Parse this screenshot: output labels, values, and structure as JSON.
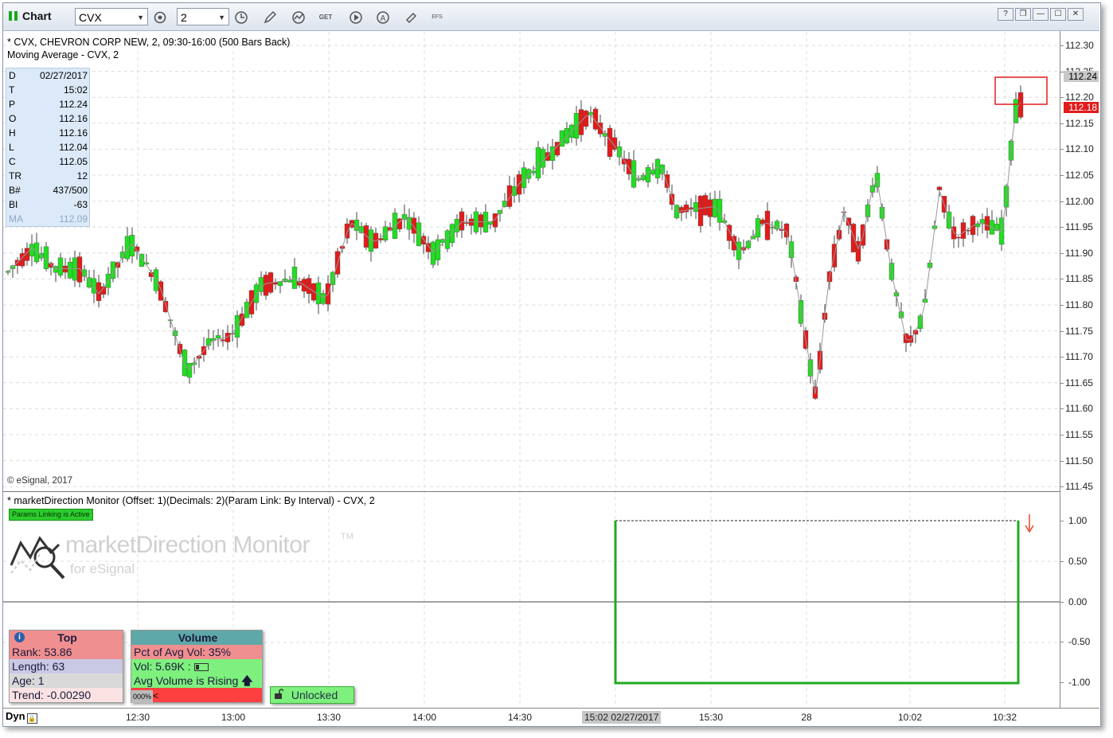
{
  "toolbar": {
    "title": "Chart",
    "symbol": "CVX",
    "interval": "2",
    "icons": [
      "settings-icon",
      "clock-icon",
      "pencil-icon",
      "study-icon",
      "get-icon",
      "play-icon",
      "alert-icon",
      "link-icon",
      "efs-icon"
    ],
    "efs_label": "EFS",
    "get_label": "GET",
    "window_buttons": [
      "?",
      "❐",
      "—",
      "☐",
      "✕"
    ]
  },
  "chart": {
    "header_line1": "* CVX, CHEVRON CORP NEW, 2, 09:30-16:00 (500 Bars Back)",
    "header_line2": "Moving Average - CVX, 2",
    "copyright": "© eSignal, 2017",
    "data_window": [
      {
        "k": "D",
        "v": "02/27/2017"
      },
      {
        "k": "T",
        "v": "15:02"
      },
      {
        "k": "P",
        "v": "112.24"
      },
      {
        "k": "O",
        "v": "112.16"
      },
      {
        "k": "H",
        "v": "112.16"
      },
      {
        "k": "L",
        "v": "112.04"
      },
      {
        "k": "C",
        "v": "112.05"
      },
      {
        "k": "TR",
        "v": "12"
      },
      {
        "k": "B#",
        "v": "437/500"
      },
      {
        "k": "BI",
        "v": "-63"
      },
      {
        "k": "MA",
        "v": "112.09"
      }
    ],
    "price_labels": [
      "112.30",
      "112.25",
      "112.20",
      "112.15",
      "112.10",
      "112.05",
      "112.00",
      "111.95",
      "111.90",
      "111.85",
      "111.80",
      "111.75",
      "111.70",
      "111.65",
      "111.60",
      "111.55",
      "111.50",
      "111.45"
    ],
    "price_badges": [
      {
        "text": "112.24",
        "bg": "#c8c8c8",
        "fg": "#000000",
        "value": 112.24
      },
      {
        "text": "112.18",
        "bg": "#e31b1b",
        "fg": "#ffffff",
        "value": 112.18
      }
    ],
    "up_color": "#22dd22",
    "down_color": "#e31b1b"
  },
  "indicator": {
    "title": "* marketDirection Monitor (Offset: 1)(Decimals: 2)(Param Link: By Interval) - CVX, 2",
    "params_badge": "Params Linking is Active",
    "logo_text": "marketDirection Monitor",
    "logo_tm": "TM",
    "logo_sub": "for eSignal",
    "axis_labels": [
      "1.00",
      "0.50",
      "0.00",
      "-0.50",
      "-1.00"
    ],
    "line_color": "#22aa22",
    "top_panel": {
      "header": "Top",
      "rows": [
        "Rank: 53.86",
        "Length: 63",
        "Age: 1",
        "Trend: -0.00290"
      ]
    },
    "volume_panel": {
      "header": "Volume",
      "rows": [
        "Pct of Avg Vol: 35%",
        "Vol: 5.69K :",
        "Avg Volume is Rising"
      ],
      "bar_label": "000%",
      "bar_arrow": "<"
    },
    "lock_label": "Unlocked"
  },
  "time_axis": {
    "dyn_label": "Dyn",
    "labels": [
      "12:30",
      "13:00",
      "13:30",
      "14:00",
      "14:30",
      "15:30",
      "28",
      "10:02",
      "10:32"
    ],
    "cursor_label": "15:02 02/27/2017"
  }
}
